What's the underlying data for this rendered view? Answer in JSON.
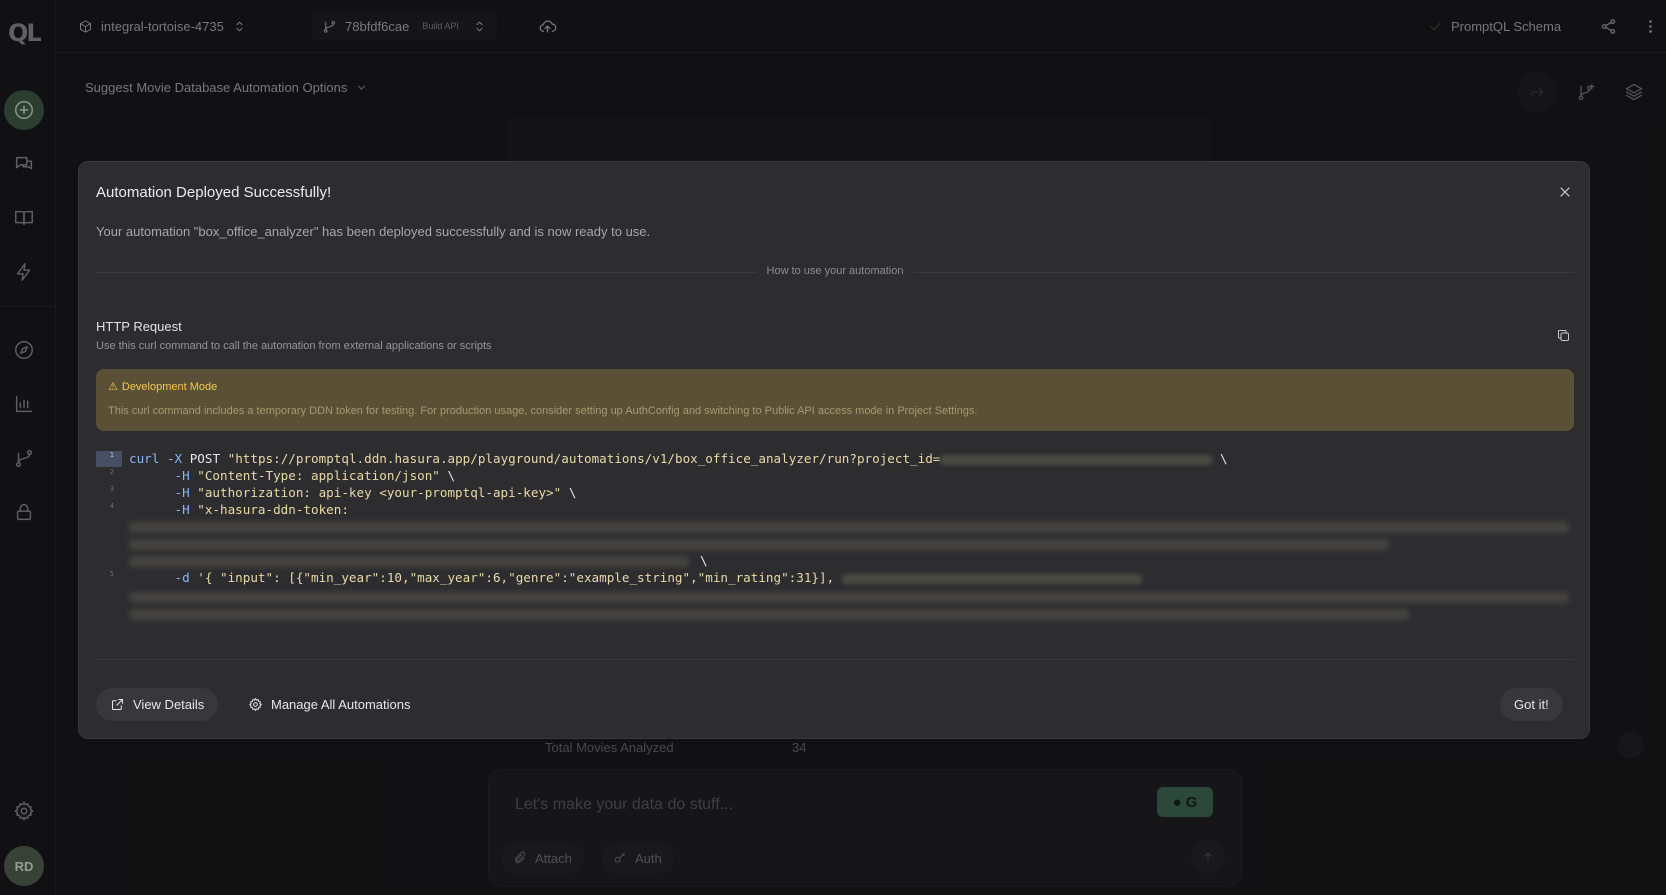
{
  "topbar": {
    "project": "integral-tortoise-4735",
    "separator": "/",
    "build_id": "78bfdf6cae",
    "build_badge": "Build API",
    "schema_label": "PromptQL Schema"
  },
  "logo": "QL",
  "thread": {
    "title": "Suggest Movie Database Automation Options"
  },
  "avatar_initials": "RD",
  "modal": {
    "title": "Automation Deployed Successfully!",
    "description": "Your automation \"box_office_analyzer\" has been deployed successfully and is now ready to use.",
    "divider_label": "How to use your automation",
    "section_title": "HTTP Request",
    "section_subtitle": "Use this curl command to call the automation from external applications or scripts",
    "warning_title": "Development Mode",
    "warning_text": "This curl command includes a temporary DDN token for testing. For production usage, consider setting up AuthConfig and switching to Public API access mode in Project Settings.",
    "code": {
      "line_numbers": [
        "1",
        "2",
        "3",
        "4",
        "5"
      ],
      "l1_cmd": "curl",
      "l1_flag": "-X",
      "l1_method": "POST",
      "l1_url": "\"https://promptql.ddn.hasura.app/playground/automations/v1/box_office_analyzer/run?project_id=",
      "l1_tail": "\\",
      "l2_flag": "-H",
      "l2_val": "\"Content-Type: application/json\"",
      "l2_tail": "\\",
      "l3_flag": "-H",
      "l3_val": "\"authorization: api-key <your-promptql-api-key>\"",
      "l3_tail": "\\",
      "l4_flag": "-H",
      "l4_val": "\"x-hasura-ddn-token:",
      "l4_tail": "\\",
      "l5_flag": "-d",
      "l5_val": "'{ \"input\": [{\"min_year\":10,\"max_year\":6,\"genre\":\"example_string\",\"min_rating\":31}],"
    },
    "view_details": "View Details",
    "manage_all": "Manage All Automations",
    "got_it": "Got it!"
  },
  "background": {
    "stat_label": "Total Movies Analyzed",
    "stat_value": "34"
  },
  "composer": {
    "placeholder": "Let's make your data do stuff...",
    "attach_label": "Attach",
    "auth_label": "Auth"
  },
  "colors": {
    "accent_green": "#3f5a45",
    "warning_bg": "#5a5035",
    "warning_text": "#f2c94c"
  }
}
